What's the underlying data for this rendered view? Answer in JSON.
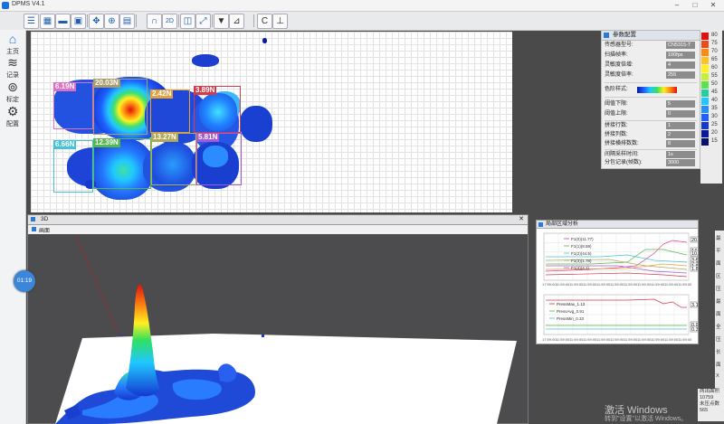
{
  "app": {
    "title": "DPMS V4.1"
  },
  "toolbar": {
    "icons": [
      "menu-icon",
      "grid-icon",
      "folder-icon",
      "save-icon",
      "pan-icon",
      "crosshair-icon",
      "table-icon",
      "magnet-icon",
      "3d-icon",
      "stack-icon",
      "zoom-fit-icon",
      "filter-icon",
      "chart-icon",
      "letter-c-icon",
      "axis-icon"
    ],
    "label_2d": "2D"
  },
  "nav": [
    {
      "label": "主页",
      "icon": "home-icon"
    },
    {
      "label": "记录",
      "icon": "database-icon"
    },
    {
      "label": "标定",
      "icon": "target-icon"
    },
    {
      "label": "配置",
      "icon": "settings-icon"
    }
  ],
  "time_bubble": "01:19",
  "zones": [
    {
      "label": "6.19N",
      "color": "#e26dc4"
    },
    {
      "label": "20.03N",
      "color": "#a99d68"
    },
    {
      "label": "2.42N",
      "color": "#e3a13c"
    },
    {
      "label": "3.89N",
      "color": "#d33b4a"
    },
    {
      "label": "6.66N",
      "color": "#44c3d6"
    },
    {
      "label": "12.39N",
      "color": "#56b84c"
    },
    {
      "label": "13.27N",
      "color": "#b2a957"
    },
    {
      "label": "5.81N",
      "color": "#a45ad1"
    }
  ],
  "params": {
    "title": "参数配置",
    "rows": [
      {
        "label": "传感器型号:",
        "value": "CN5315-T"
      },
      {
        "label": "扫描帧率:",
        "value": "100fps"
      },
      {
        "label": "灵敏度倍增:",
        "value": "4"
      },
      {
        "label": "灵敏度倍率:",
        "value": "255"
      },
      {
        "label": "色阶样式:",
        "value": ""
      },
      {
        "label": "阈值下限:",
        "value": "5"
      },
      {
        "label": "阈值上限:",
        "value": "0"
      },
      {
        "label": "拼接行数:",
        "value": "1"
      },
      {
        "label": "拼接列数:",
        "value": "2"
      },
      {
        "label": "拼接横排数数:",
        "value": "8"
      },
      {
        "label": "间隔采样时间:",
        "value": "1s"
      },
      {
        "label": "分包记录(帧数):",
        "value": "3000"
      }
    ]
  },
  "legend": {
    "colors": [
      "#e01010",
      "#f04a18",
      "#ff8a10",
      "#ffc020",
      "#fff020",
      "#c8f030",
      "#60e050",
      "#20d0a0",
      "#20c8ff",
      "#2090ff",
      "#1e5fff",
      "#1438d0",
      "#0a1aa0",
      "#061070"
    ],
    "values": [
      "80",
      "75",
      "70",
      "65",
      "60",
      "55",
      "50",
      "45",
      "40",
      "35",
      "30",
      "25",
      "20",
      "15"
    ]
  },
  "panel3d": {
    "title": "3D",
    "tab": "画面"
  },
  "analysis": {
    "title": "局部区域分析",
    "top_series": [
      "F1(0)(11.77)",
      "F1(1)(8.59)",
      "F1(2)(44.5)",
      "F1(3)(1.78)",
      "F1(4)(4.1)"
    ],
    "top_values": [
      "20.79",
      "14.24",
      "10.73",
      "3.63",
      "2.39",
      "1.87",
      "1.85"
    ],
    "bottom_series": [
      "PressMax_1.13",
      "PressAvg_0.91",
      "PressMin_0.33"
    ],
    "bottom_values": [
      "3.13",
      "0.91",
      "0.32"
    ],
    "x_ticks": [
      "17:59:00",
      "11:59:00",
      "11:59:00",
      "11:59:00",
      "11:59:00",
      "11:59:00",
      "11:59:00",
      "11:59:00",
      "11:59:00",
      "11:59:00",
      "11:59:00"
    ]
  },
  "right_edge": [
    "最",
    "平",
    "面",
    "区",
    "压",
    "最",
    "面",
    "全",
    "压",
    "长",
    "面",
    "X"
  ],
  "bottom_info": [
    "两出面积",
    "10759",
    "未压点数",
    "565"
  ],
  "watermark": {
    "line1": "激活 Windows",
    "line2": "转到\"设置\"以激活 Windows。"
  }
}
